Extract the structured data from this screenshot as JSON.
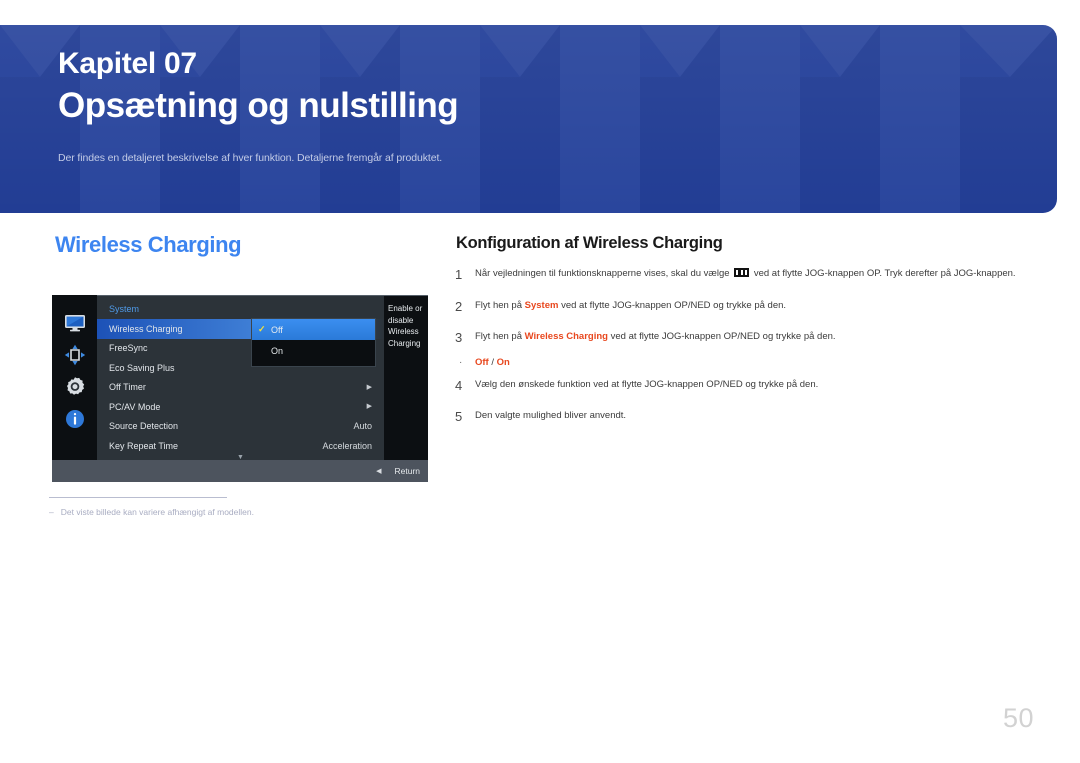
{
  "header": {
    "chapter_label": "Kapitel 07",
    "chapter_title": "Opsætning og nulstilling",
    "subtitle": "Der findes en detaljeret beskrivelse af hver funktion. Detaljerne fremgår af produktet.",
    "bg_color": "#24409a"
  },
  "section": {
    "title": "Wireless Charging",
    "title_color": "#3d85f0"
  },
  "osd": {
    "sidebar_icons": [
      "monitor-icon",
      "directional-pad-icon",
      "gear-icon",
      "info-icon"
    ],
    "menu_heading": "System",
    "rows": [
      {
        "label": "Wireless Charging",
        "value": "",
        "arrow": "",
        "selected": true
      },
      {
        "label": "FreeSync",
        "value": "",
        "arrow": "",
        "selected": false
      },
      {
        "label": "Eco Saving Plus",
        "value": "",
        "arrow": "",
        "selected": false
      },
      {
        "label": "Off Timer",
        "value": "",
        "arrow": "▶",
        "selected": false
      },
      {
        "label": "PC/AV Mode",
        "value": "",
        "arrow": "▶",
        "selected": false
      },
      {
        "label": "Source Detection",
        "value": "Auto",
        "arrow": "",
        "selected": false
      },
      {
        "label": "Key Repeat Time",
        "value": "Acceleration",
        "arrow": "",
        "selected": false
      }
    ],
    "scroll_indicator": "▼",
    "dropdown": {
      "options": [
        {
          "label": "Off",
          "checked": true,
          "selected": true
        },
        {
          "label": "On",
          "checked": false,
          "selected": false
        }
      ],
      "check_glyph": "✓",
      "check_color": "#f5e23c"
    },
    "description": "Enable or disable Wireless Charging",
    "bottom_bar": {
      "back_icon": "◀",
      "return_label": "Return"
    }
  },
  "footnote": {
    "dash": "–",
    "text": "Det viste billede kan variere afhængigt af modellen."
  },
  "instructions": {
    "title": "Konfiguration af Wireless Charging",
    "steps": [
      {
        "num": "1",
        "parts": [
          {
            "t": "Når vejledningen til funktionsknapperne vises, skal du vælge ",
            "style": "plain"
          },
          {
            "t": "menu-glyph",
            "style": "glyph"
          },
          {
            "t": " ved at flytte JOG-knappen OP. Tryk derefter på JOG-knappen.",
            "style": "plain"
          }
        ]
      },
      {
        "num": "2",
        "parts": [
          {
            "t": "Flyt hen på ",
            "style": "plain"
          },
          {
            "t": "System",
            "style": "highlight"
          },
          {
            "t": " ved at flytte JOG-knappen OP/NED og trykke på den.",
            "style": "plain"
          }
        ]
      },
      {
        "num": "3",
        "parts": [
          {
            "t": "Flyt hen på ",
            "style": "plain"
          },
          {
            "t": "Wireless Charging",
            "style": "highlight"
          },
          {
            "t": " ved at flytte JOG-knappen OP/NED og trykke på den.",
            "style": "plain"
          }
        ]
      }
    ],
    "bullet": {
      "dot": "·",
      "option_off": "Off",
      "separator": " / ",
      "option_on": "On"
    },
    "steps_after": [
      {
        "num": "4",
        "parts": [
          {
            "t": "Vælg den ønskede funktion ved at flytte JOG-knappen OP/NED og trykke på den.",
            "style": "plain"
          }
        ]
      },
      {
        "num": "5",
        "parts": [
          {
            "t": "Den valgte mulighed bliver anvendt.",
            "style": "plain"
          }
        ]
      }
    ],
    "highlight_color": "#e8481f"
  },
  "page_number": "50"
}
